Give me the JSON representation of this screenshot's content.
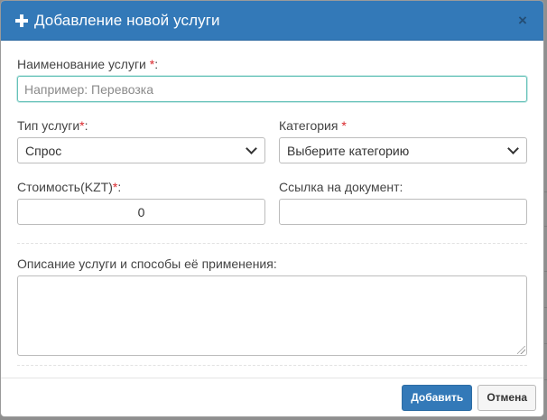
{
  "modal": {
    "title": "Добавление новой услуги",
    "close_label": "×"
  },
  "form": {
    "name": {
      "label": "Наименование услуги",
      "required_mark": "*",
      "suffix": ":",
      "placeholder": "Например: Перевозка",
      "value": ""
    },
    "type": {
      "label": "Тип услуги",
      "required_mark": "*",
      "suffix": ":",
      "selected": "Спрос"
    },
    "category": {
      "label": "Категория",
      "required_mark": "*",
      "selected": "Выберите категорию"
    },
    "cost": {
      "label": "Стоимость(KZT)",
      "required_mark": "*",
      "suffix": ":",
      "value": "0"
    },
    "document_link": {
      "label": "Ссылка на документ:",
      "value": ""
    },
    "description": {
      "label": "Описание услуги и способы её применения:",
      "value": ""
    }
  },
  "footer": {
    "add_label": "Добавить",
    "cancel_label": "Отмена"
  },
  "colors": {
    "header_bg": "#3379b8",
    "primary_button": "#3379b8",
    "required": "#d9262b",
    "focus_border": "#66c2b9"
  },
  "icons": [
    "plus-icon",
    "close-icon",
    "chevron-down-icon",
    "resize-grip-icon"
  ]
}
